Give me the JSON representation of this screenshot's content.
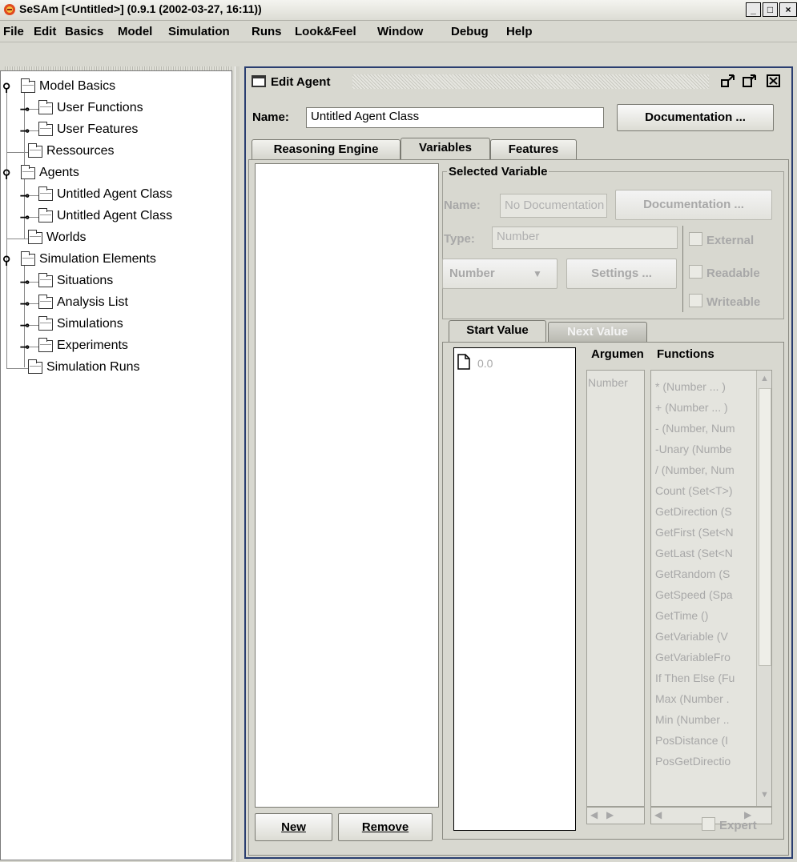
{
  "window": {
    "title": "SeSAm [<Untitled>] (0.9.1 (2002-03-27, 16:11))",
    "minimize": "_",
    "maximize": "□",
    "close": "×"
  },
  "menu": [
    "File",
    "Edit",
    "Basics",
    "Model",
    "Simulation",
    "Runs",
    "Look&Feel",
    "Window",
    "Debug",
    "Help"
  ],
  "tree": {
    "items": [
      {
        "label": "Model Basics"
      },
      {
        "label": "User Functions"
      },
      {
        "label": "User Features"
      },
      {
        "label": "Ressources"
      },
      {
        "label": "Agents"
      },
      {
        "label": "Untitled Agent Class"
      },
      {
        "label": "Untitled Agent Class"
      },
      {
        "label": "Worlds"
      },
      {
        "label": "Simulation Elements"
      },
      {
        "label": "Situations"
      },
      {
        "label": "Analysis List"
      },
      {
        "label": "Simulations"
      },
      {
        "label": "Experiments"
      },
      {
        "label": "Simulation Runs"
      }
    ]
  },
  "editor": {
    "title": "Edit Agent",
    "name_label": "Name:",
    "name_value": "Untitled Agent Class",
    "documentation_button": "Documentation ...",
    "tabs": [
      "Reasoning Engine",
      "Variables",
      "Features"
    ],
    "active_tab": "Variables",
    "new_button": "New",
    "remove_button": "Remove",
    "selected_variable": {
      "group_title": "Selected Variable",
      "name_label": "Name:",
      "name_value": "No Documentation",
      "documentation_button": "Documentation ...",
      "type_label": "Type:",
      "type_value": "Number",
      "type_select": "Number",
      "settings_button": "Settings ...",
      "external": "External",
      "readable": "Readable",
      "writeable": "Writeable"
    },
    "value_tabs": [
      "Start Value",
      "Next Value"
    ],
    "start_value": "0.0",
    "arguments": {
      "title": "Argumen",
      "items": [
        "Number"
      ]
    },
    "functions": {
      "title": "Functions",
      "items": [
        "* (Number ... )",
        "+ (Number ... )",
        "- (Number, Num",
        "-Unary (Numbe",
        "/ (Number, Num",
        "Count (Set<T>)",
        "GetDirection (S",
        "GetFirst (Set<N",
        "GetLast (Set<N",
        "GetRandom (S",
        "GetSpeed (Spa",
        "GetTime ()",
        "GetVariable (V",
        "GetVariableFro",
        "If Then Else (Fu",
        "Max (Number .",
        "Min (Number ..",
        "PosDistance (I",
        "PosGetDirectio"
      ]
    },
    "expert": "Expert"
  }
}
